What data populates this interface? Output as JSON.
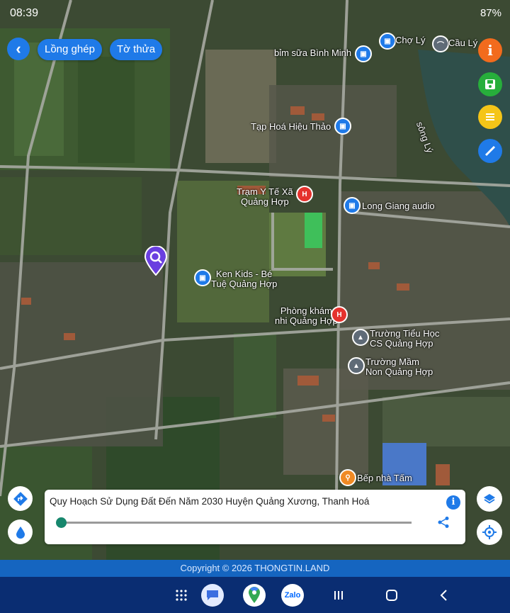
{
  "status_bar": {
    "time": "08:39",
    "battery": "87%"
  },
  "toolbar": {
    "back_label": "‹",
    "overlay_label": "Lồng ghép",
    "parcel_label": "Tờ thửa"
  },
  "map_labels": {
    "cho_ly": "Chợ Lý",
    "cau_ly": "Cầu Lý",
    "binh_minh": "bỉm sữa Bình Minh",
    "song_ly": "sông Lý",
    "tap_hoa": "Tạp Hoá Hiệu Thảo",
    "tram_y_te_1": "Trạm Y Tế Xã",
    "tram_y_te_2": "Quảng Hợp",
    "long_giang": "Long Giang audio",
    "ken_kids_1": "Ken Kids - Bé",
    "ken_kids_2": "Tuệ Quảng Hợp",
    "phong_kham_1": "Phòng khám",
    "phong_kham_2": "nhi Quảng Hợp",
    "tieu_hoc_1": "Trường Tiểu Học",
    "tieu_hoc_2": "CS Quảng Hợp",
    "mam_non_1": "Trường Mầm",
    "mam_non_2": "Non Quảng Hợp",
    "bep_nha_tam": "Bếp nhà Tấm"
  },
  "panel": {
    "title": "Quy Hoạch Sử Dụng Đất Đến Năm 2030 Huyện Quảng Xương, Thanh Hoá",
    "opacity": 0.0
  },
  "footer": {
    "copyright": "Copyright © 2026 THONGTIN.LAND"
  },
  "colors": {
    "accent": "#1f7ae8",
    "info_orange": "#f26b1d",
    "save_green": "#27ae3b",
    "list_yellow": "#f5c518",
    "footer_blue": "#1565c0",
    "nav_blue": "#0a2d72"
  }
}
